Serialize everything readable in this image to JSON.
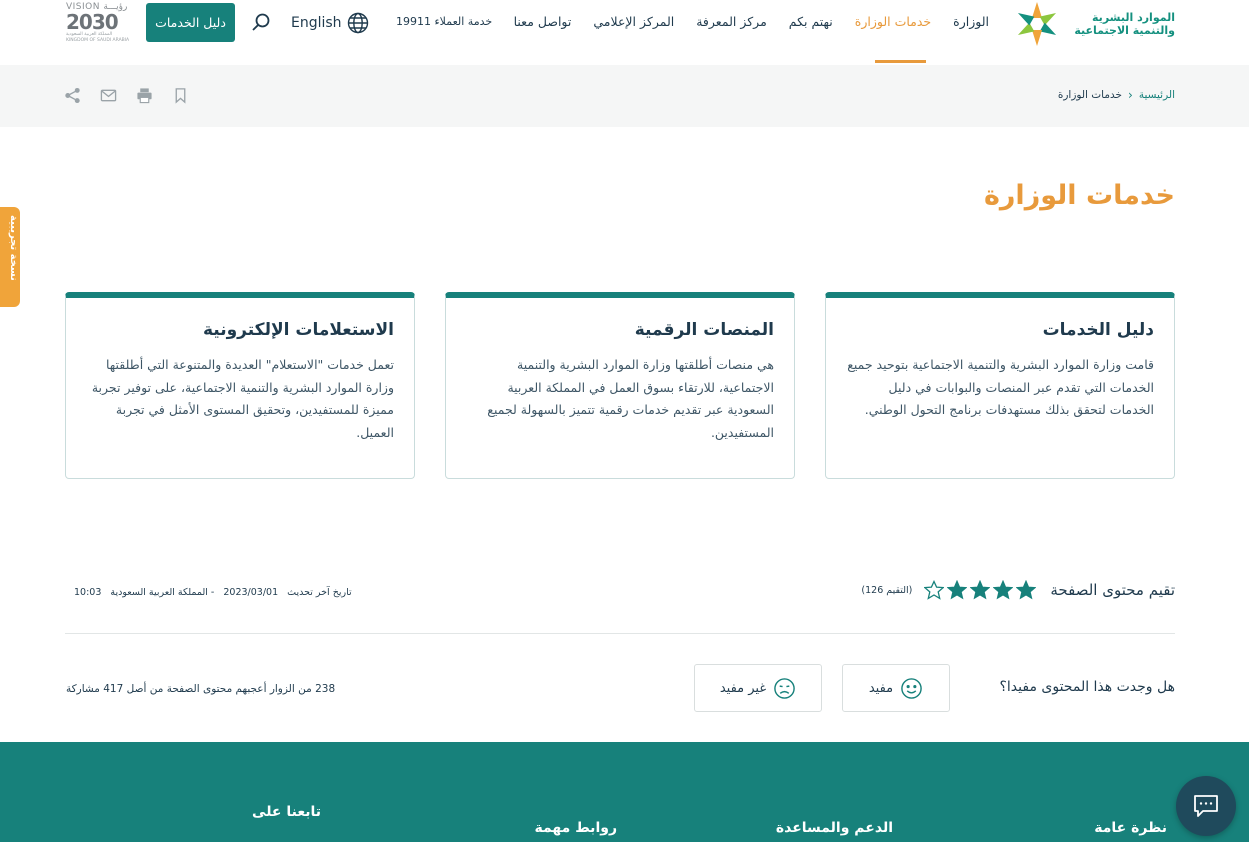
{
  "header": {
    "logo_line1": "الموارد البشرية",
    "logo_line2": "والتنمية الاجتماعية",
    "nav": [
      {
        "label": "الوزارة",
        "active": false
      },
      {
        "label": "خدمات الوزارة",
        "active": true
      },
      {
        "label": "نهتم بكم",
        "active": false
      },
      {
        "label": "مركز المعرفة",
        "active": false
      },
      {
        "label": "المركز الإعلامي",
        "active": false
      },
      {
        "label": "تواصل معنا",
        "active": false
      }
    ],
    "hotline": "خدمة العملاء 19911",
    "language": "English",
    "guide_button": "دليل الخدمات",
    "vision_top": "VISION رؤيـــة",
    "vision_year": "2030",
    "vision_sub": "المملكة العربية السعودية KINGDOM OF SAUDI ARABIA"
  },
  "breadcrumb": {
    "home": "الرئيسية",
    "current": "خدمات الوزارة"
  },
  "page": {
    "title": "خدمات الوزارة"
  },
  "cards": [
    {
      "title": "دليل الخدمات",
      "desc": "قامت وزارة الموارد البشرية والتنمية الاجتماعية بتوحيد جميع الخدمات التي تقدم عبر المنصات والبوابات في دليل الخدمات لتحقق بذلك مستهدفات برنامج التحول الوطني."
    },
    {
      "title": "المنصات الرقمية",
      "desc": "هي منصات أطلقتها وزارة الموارد البشرية والتنمية الاجتماعية، للارتقاء بسوق العمل في المملكة العربية السعودية عبر تقديم خدمات رقمية تتميز بالسهولة لجميع المستفيدين."
    },
    {
      "title": "الاستعلامات الإلكترونية",
      "desc": "تعمل خدمات \"الاستعلام\" العديدة والمتنوعة التي أطلقتها وزارة الموارد البشرية والتنمية الاجتماعية، على توفير تجربة مميزة للمستفيدين، وتحقيق المستوى الأمثل في تجربة العميل."
    }
  ],
  "rating": {
    "label": "تقيم محتوى الصفحة",
    "filled_stars": 4,
    "total_stars": 5,
    "count": "(التقيم 126)"
  },
  "updated": {
    "label": "تاريخ آخر تحديث",
    "date": "2023/03/01",
    "place": "- المملكة العربية السعودية",
    "time": "10:03"
  },
  "feedback": {
    "question": "هل وجدت هذا المحتوى مفيدا؟",
    "yes": "مفيد",
    "no": "غير مفيد",
    "stat": "238 من الزوار أعجبهم محتوى الصفحة من أصل 417 مشاركة"
  },
  "footer": {
    "col1": "نظرة عامة",
    "col2": "الدعم والمساعدة",
    "col3": "روابط مهمة",
    "col4": "تابعنا على"
  },
  "side_tab": "نسخة تجريبية",
  "colors": {
    "brand": "#17817b",
    "accent": "#e89a3c",
    "text": "#1f3a4d"
  }
}
